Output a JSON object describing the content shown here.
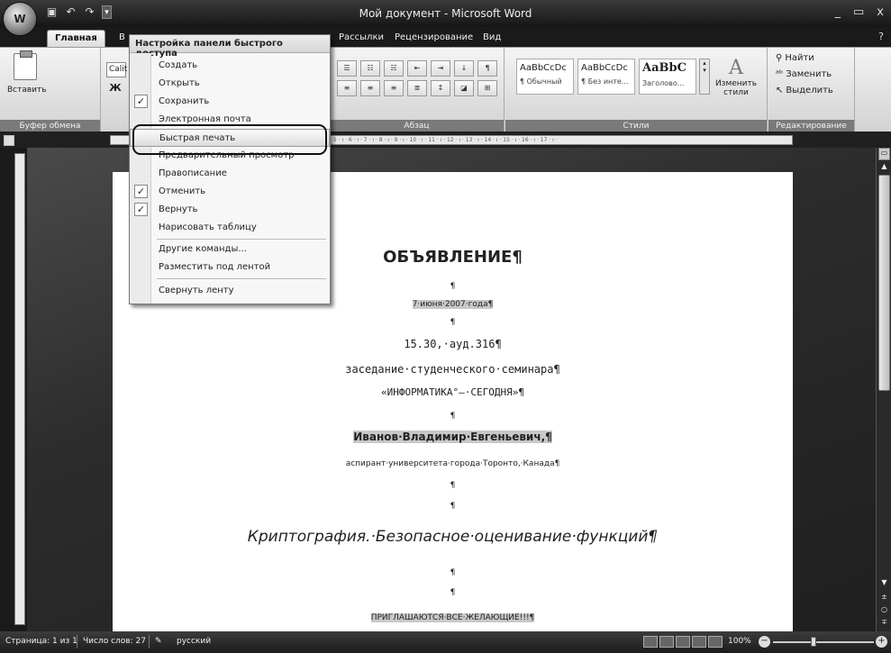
{
  "window": {
    "title": "Мой документ - Microsoft Word",
    "office_button_label": "W",
    "minimize": "_",
    "maximize": "▭",
    "close": "x"
  },
  "tabs": [
    {
      "label": "Главная",
      "active": true
    },
    {
      "label": "В"
    },
    {
      "label": "Рассылки"
    },
    {
      "label": "Рецензирование"
    },
    {
      "label": "Вид"
    }
  ],
  "help_icon": "?",
  "ribbon": {
    "clipboard": {
      "paste": "Вставить",
      "label": "Буфер обмена"
    },
    "font": {
      "name": "Calit",
      "bold": "Ж"
    },
    "paragraph": {
      "label": "Абзац"
    },
    "styles": {
      "label": "Стили",
      "items": [
        {
          "sample": "AaBbCcDc",
          "name": "¶ Обычный"
        },
        {
          "sample": "AaBbCcDc",
          "name": "¶ Без инте..."
        },
        {
          "sample": "AaBbC",
          "name": "Заголово..."
        }
      ],
      "change_styles": "Изменить стили"
    },
    "editing": {
      "label": "Редактирование",
      "find": "Найти",
      "replace": "Заменить",
      "select": "Выделить"
    }
  },
  "qat_menu": {
    "header": "Настройка панели быстрого доступа",
    "items": [
      {
        "label": "Создать",
        "checked": false
      },
      {
        "label": "Открыть",
        "checked": false
      },
      {
        "label": "Сохранить",
        "checked": true
      },
      {
        "label": "Электронная почта",
        "checked": false
      },
      {
        "label": "Быстрая печать",
        "checked": false,
        "highlighted": true
      },
      {
        "label": "Предварительный просмотр",
        "checked": false
      },
      {
        "label": "Правописание",
        "checked": false
      },
      {
        "label": "Отменить",
        "checked": true
      },
      {
        "label": "Вернуть",
        "checked": true
      },
      {
        "label": "Нарисовать таблицу",
        "checked": false
      },
      {
        "label": "Другие команды...",
        "checked": false
      },
      {
        "label": "Разместить под лентой",
        "checked": false
      },
      {
        "label": "Свернуть ленту",
        "checked": false
      }
    ]
  },
  "ruler": {
    "numbers": "4 · ı · 5 · ı · 6 · ı · 7 · ı · 8 · ı · 9 · ı · 10 · ı · 11 · ı · 12 · ı · 13 · ı · 14 · ı · 15 · ı · 16 · ı · 17 · ı ·"
  },
  "document": {
    "heading": "ОБЪЯВЛЕНИЕ¶",
    "pilcrow": "¶",
    "date": "7·июня·2007·года¶",
    "time": "15.30,·ауд.316¶",
    "event": "заседание·студенческого·семинара¶",
    "seminar": "«ИНФОРМАТИКА°—·СЕГОДНЯ»¶",
    "speaker": "Иванов·Владимир·Евгеньевич,¶",
    "affiliation": "аспирант·университета·города·Торонто,·Канада¶",
    "topic": "Криптография.·Безопасное·оценивание·функций¶",
    "invite": "ПРИГЛАШАЮТСЯ·ВСЕ·ЖЕЛАЮЩИЕ!!!¶"
  },
  "statusbar": {
    "page": "Страница: 1 из 1",
    "words": "Число слов: 27",
    "language": "русский",
    "zoom": "100%"
  }
}
